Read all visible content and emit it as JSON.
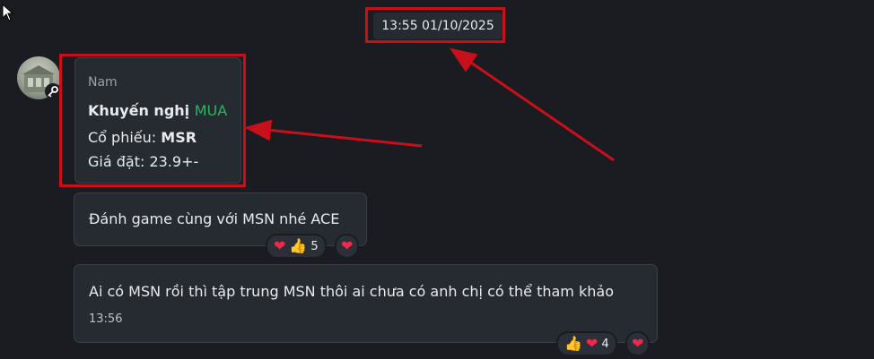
{
  "timestamp": "13:55 01/10/2025",
  "messages": [
    {
      "sender": "Nam",
      "title_prefix": "Khuyến nghị",
      "title_action": "MUA",
      "stock_label": "Cổ phiếu:",
      "stock_ticker": "MSR",
      "price_line": "Giá đặt: 23.9+-"
    },
    {
      "text": "Đánh game cùng với MSN nhé ACE",
      "reactions": [
        {
          "icons": [
            "heart-icon",
            "thumbs-up-icon"
          ],
          "count": "5"
        },
        {
          "icons": [
            "heart-icon"
          ],
          "count": ""
        }
      ]
    },
    {
      "text": "Ai có MSN rồi thì tập trung MSN thôi ai chưa có anh chị có thể tham khảo",
      "time": "13:56",
      "reactions": [
        {
          "icons": [
            "thumbs-up-icon",
            "heart-icon"
          ],
          "count": "4"
        },
        {
          "icons": [
            "heart-icon"
          ],
          "count": ""
        }
      ]
    }
  ],
  "colors": {
    "background": "#1a1c21",
    "bubble": "#262a31",
    "annotation": "#c8101a",
    "buy": "#2db563",
    "heart": "#f02849"
  }
}
